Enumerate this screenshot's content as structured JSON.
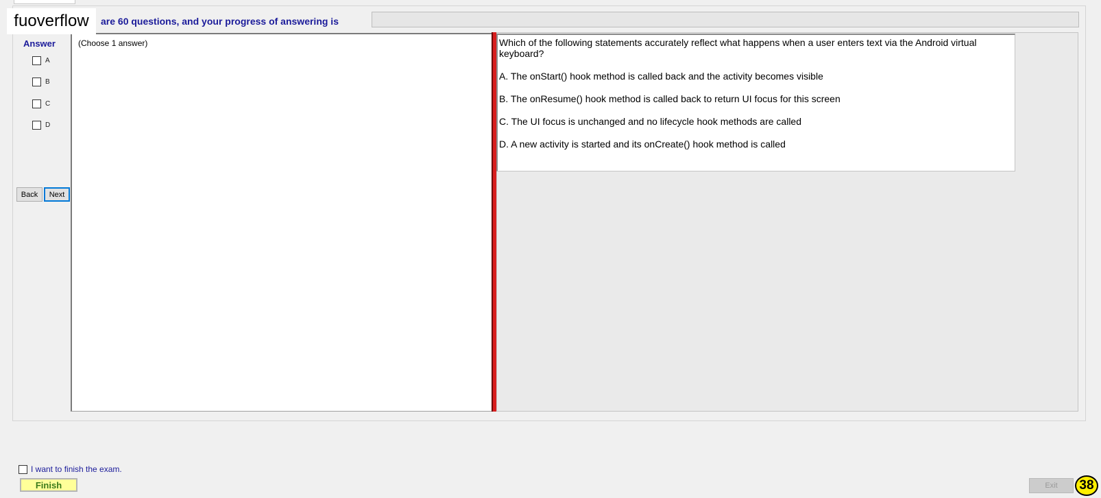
{
  "watermark": "fuoverflow",
  "header": {
    "progress_text": "are 60 questions, and your progress of answering is",
    "progress_fraction": 0
  },
  "answer_panel": {
    "heading": "Answer",
    "options": [
      "A",
      "B",
      "C",
      "D"
    ],
    "back_label": "Back",
    "next_label": "Next"
  },
  "notes": {
    "hint": "(Choose 1 answer)"
  },
  "question": {
    "stem": "Which of the following statements accurately reflect what happens when a user enters text via the Android virtual keyboard?",
    "choices": [
      "A.  The onStart() hook method is called back and the activity becomes visible",
      "B.  The onResume() hook method is called back to return UI focus for this screen",
      "C.  The UI focus is unchanged and no lifecycle hook methods are called",
      "D.  A new activity is started and its onCreate() hook method is called"
    ]
  },
  "footer": {
    "finish_check_label": "I want to finish the exam.",
    "finish_label": "Finish",
    "exit_label": "Exit",
    "page_badge": "38"
  }
}
